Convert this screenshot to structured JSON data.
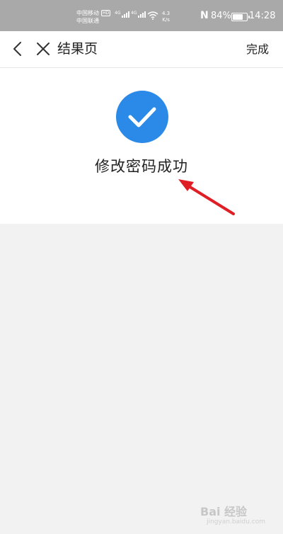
{
  "status_bar": {
    "carrier_1": "中国移动",
    "carrier_1_badge": "HD",
    "carrier_2": "中国联通",
    "network_1": "4G",
    "network_2": "4G",
    "speed_value": "4.3",
    "speed_unit": "K/s",
    "nfc": "N",
    "battery_percent": "84%",
    "battery_level": 0.84,
    "time": "14:28"
  },
  "nav": {
    "back_icon": "chevron-left-icon",
    "close_icon": "close-icon",
    "title": "结果页",
    "done_label": "完成"
  },
  "result": {
    "icon": "check-circle-icon",
    "icon_color": "#2b8ae8",
    "message": "修改密码成功"
  },
  "annotation": {
    "arrow_color": "#e01e25"
  },
  "watermark": {
    "text": "Bai 经验",
    "sub": "jingyan.baidu.com"
  }
}
